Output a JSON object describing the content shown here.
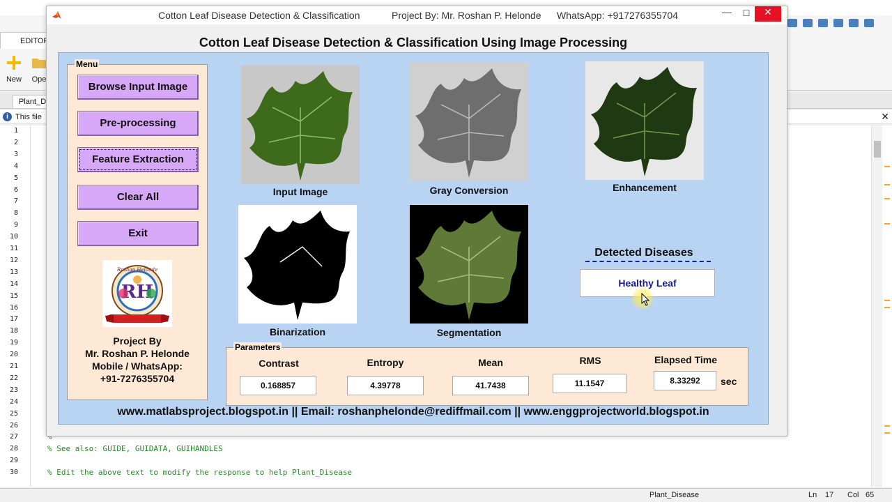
{
  "background_editor": {
    "editor_tab": "EDITOR",
    "ribbon": {
      "new_label": "New",
      "open_label": "Ope"
    },
    "file_tab": "Plant_D",
    "info_text": "This file",
    "code_lines": [
      {
        "no": "27",
        "text": "%"
      },
      {
        "no": "28",
        "text": "% See also: GUIDE, GUIDATA, GUIHANDLES"
      },
      {
        "no": "29",
        "text": ""
      },
      {
        "no": "30",
        "text": "% Edit the above text to modify the response to help Plant_Disease"
      }
    ],
    "line_numbers": [
      "1",
      "2",
      "3",
      "4",
      "5",
      "6",
      "7",
      "8",
      "9",
      "10",
      "11",
      "12",
      "13",
      "14",
      "15",
      "16",
      "17",
      "18",
      "19",
      "20",
      "21",
      "22",
      "23",
      "24",
      "25",
      "26",
      "27",
      "28",
      "29",
      "30"
    ],
    "status": {
      "file": "Plant_Disease",
      "ln_label": "Ln",
      "ln": "17",
      "col_label": "Col",
      "col": "65"
    }
  },
  "window": {
    "title": "Cotton Leaf Disease Detection & Classification",
    "project_by": "Project By: Mr. Roshan P. Helonde",
    "whatsapp": "WhatsApp: +917276355704",
    "minimize_icon": "—",
    "maximize_icon": "☐",
    "close_icon": "✕"
  },
  "heading": "Cotton Leaf Disease Detection & Classification Using Image Processing",
  "menu": {
    "legend": "Menu",
    "buttons": {
      "browse": "Browse Input Image",
      "preprocess": "Pre-processing",
      "features": "Feature Extraction",
      "clear": "Clear All",
      "exit": "Exit"
    },
    "logo_text": "Roshan Helonde",
    "logo_initials": "RH",
    "project_lines": [
      "Project By",
      "Mr. Roshan P. Helonde",
      "Mobile / WhatsApp:",
      "+91-7276355704"
    ]
  },
  "images": {
    "input": "Input Image",
    "gray": "Gray Conversion",
    "enhancement": "Enhancement",
    "binarization": "Binarization",
    "segmentation": "Segmentation"
  },
  "detection": {
    "title": "Detected Diseases",
    "result": "Healthy Leaf"
  },
  "parameters": {
    "legend": "Parameters",
    "contrast_label": "Contrast",
    "contrast": "0.168857",
    "entropy_label": "Entropy",
    "entropy": "4.39778",
    "mean_label": "Mean",
    "mean": "41.7438",
    "rms_label": "RMS",
    "rms": "11.1547",
    "elapsed_label": "Elapsed Time",
    "elapsed": "8.33292",
    "unit": "sec"
  },
  "footer": "www.matlabsproject.blogspot.in  ||  Email: roshanphelonde@rediffmail.com  ||  www.enggprojectworld.blogspot.in",
  "colors": {
    "panel_blue": "#b9d3f3",
    "menu_peach": "#fde9d6",
    "button_purple": "#d7a8f7",
    "result_blue": "#1a1a9a",
    "close_red": "#e81123"
  }
}
